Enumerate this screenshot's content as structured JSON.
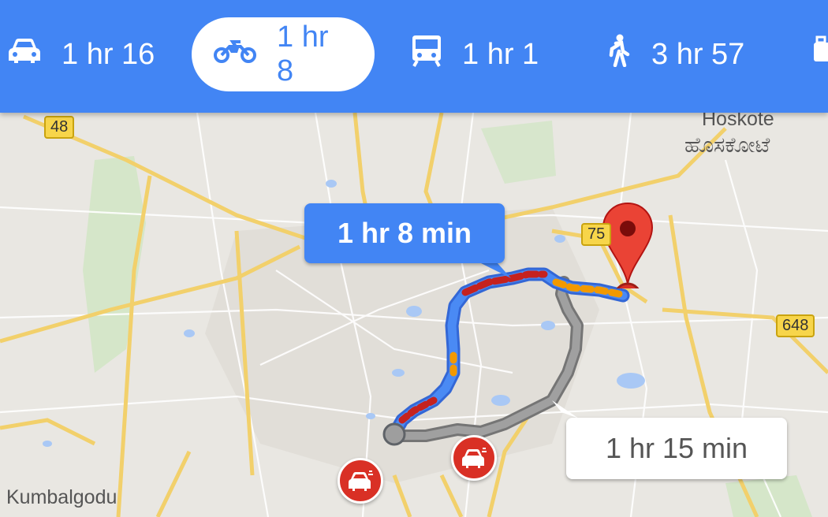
{
  "modes": [
    {
      "id": "car",
      "icon": "car-icon",
      "label": "1 hr 16"
    },
    {
      "id": "motorbike",
      "icon": "motorbike-icon",
      "label": "1 hr 8",
      "selected": true
    },
    {
      "id": "transit",
      "icon": "transit-icon",
      "label": "1 hr 1"
    },
    {
      "id": "walk",
      "icon": "walk-icon",
      "label": "3 hr 57"
    },
    {
      "id": "more",
      "icon": "ride-icon",
      "label": ""
    }
  ],
  "map": {
    "place_labels": {
      "hoskote_en": "Hoskote",
      "hoskote_kn": "ಹೊಸಕೋಟೆ",
      "kumbalgodu": "Kumbalgodu"
    },
    "shields": {
      "s48": "48",
      "s75": "75",
      "s648": "648"
    },
    "route_primary_time": "1 hr 8 min",
    "route_alt_time": "1 hr 15 min"
  },
  "colors": {
    "accent": "#4285f4",
    "pin": "#d93025",
    "traffic_red": "#c5221f",
    "traffic_orange": "#f29900",
    "alt_route": "#9e9e9e"
  }
}
